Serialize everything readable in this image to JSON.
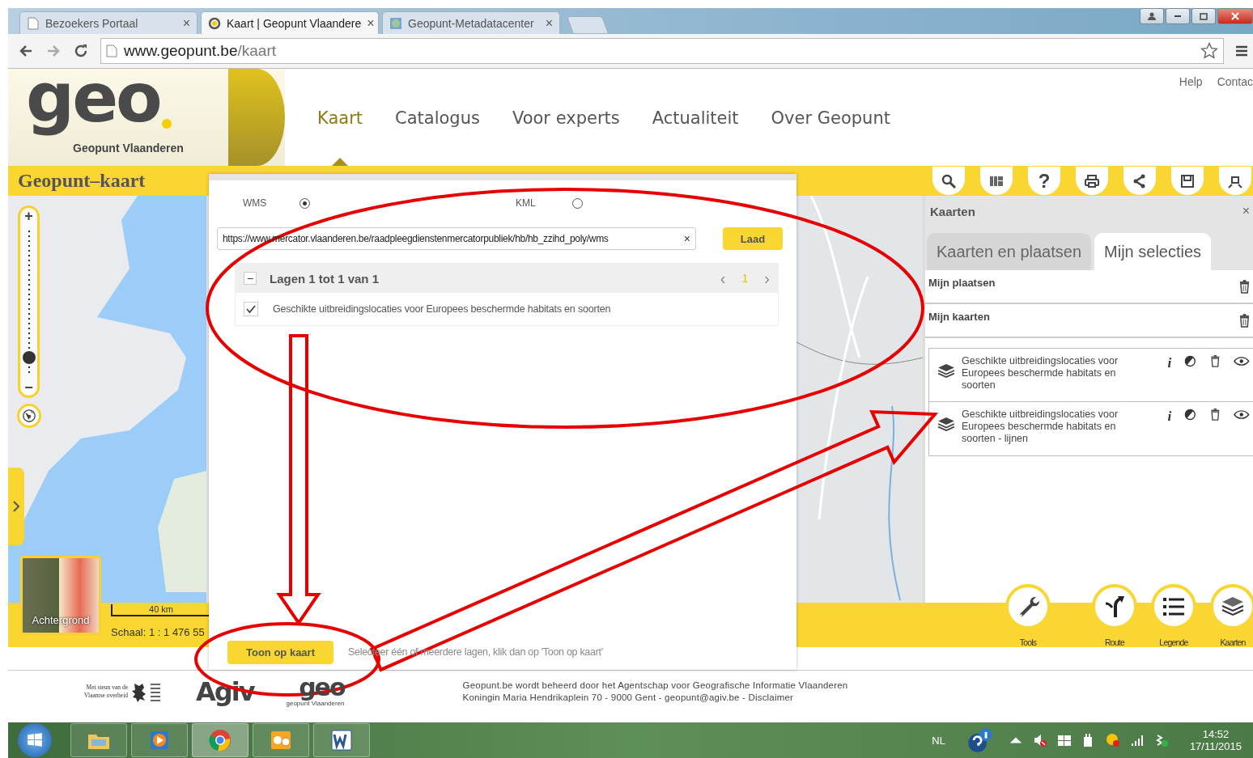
{
  "browser": {
    "tabs": [
      {
        "title": "Bezoekers Portaal",
        "close": "×",
        "selected": false,
        "kind": "page"
      },
      {
        "title": "Kaart | Geopunt Vlaandere",
        "close": "×",
        "selected": true,
        "kind": "geo"
      },
      {
        "title": "Geopunt-Metadatacenter",
        "close": "×",
        "selected": false,
        "kind": "globe"
      }
    ],
    "address": {
      "host": "www.geopunt.be",
      "path": "/kaart"
    }
  },
  "header": {
    "logo": {
      "text": "geo",
      "subtitle": "Geopunt Vlaanderen"
    },
    "nav": [
      {
        "label": "Kaart",
        "selected": true
      },
      {
        "label": "Catalogus",
        "selected": false
      },
      {
        "label": "Voor experts",
        "selected": false
      },
      {
        "label": "Actualiteit",
        "selected": false
      },
      {
        "label": "Over Geopunt",
        "selected": false
      }
    ],
    "links": [
      "Help",
      "Contac"
    ]
  },
  "map": {
    "title": "Geopunt–kaart",
    "toolbar_help": "?",
    "zoom": {
      "plus": "+",
      "minus": "−",
      "level": 0.08
    },
    "background_label": "Achtergrond",
    "scale_bar": "40 km",
    "scale": "Schaal: 1 : 1 476 55"
  },
  "dialog": {
    "formats": [
      {
        "label": "WMS",
        "selected": true
      },
      {
        "label": "KML",
        "selected": false
      }
    ],
    "url": "https://www.mercator.vlaanderen.be/raadpleegdienstenmercatorpubliek/hb/hb_zzihd_poly/wms",
    "clear": "×",
    "load": "Laad",
    "layers": {
      "collapse": "−",
      "title": "Lagen 1 tot 1 van 1",
      "prev": "‹",
      "page": "1",
      "next": "›",
      "items": [
        {
          "label": "Geschikte uitbreidingslocaties voor Europees beschermde habitats en soorten",
          "checked": true
        }
      ]
    },
    "show": "Toon op kaart",
    "hint": "Selecteer één of meerdere lagen, klik dan op 'Toon op kaart'"
  },
  "panel": {
    "title": "Kaarten",
    "close": "×",
    "tabs": [
      {
        "label": "Kaarten en plaatsen",
        "selected": false
      },
      {
        "label": "Mijn selecties",
        "selected": true
      }
    ],
    "sections": [
      "Mijn plaatsen",
      "Mijn kaarten"
    ],
    "layers": [
      {
        "label": "Geschikte uitbreidingslocaties voor Europees beschermde habitats en soorten",
        "info": "i"
      },
      {
        "label": "Geschikte uitbreidingslocaties voor Europees beschermde habitats en soorten - lijnen",
        "info": "i"
      }
    ]
  },
  "actions": [
    {
      "label": "Tools",
      "kind": "tools"
    },
    {
      "label": "Route",
      "kind": "route"
    },
    {
      "label": "Legende",
      "kind": "legend"
    },
    {
      "label": "Kaarten",
      "kind": "layers"
    }
  ],
  "footer": {
    "sponsor": "Met steun van de Vlaamse overheid",
    "agiv": "Agiv",
    "geo": "geo",
    "geo_sub": "geopunt Vlaanderen",
    "lines": [
      "Geopunt.be wordt beheerd door het Agentschap voor Geografische Informatie Vlaanderen",
      "Koningin Maria Hendrikaplein 70 - 9000 Gent - geopunt@agiv.be - Disclaimer"
    ]
  },
  "taskbar": {
    "apps": [
      {
        "kind": "explorer",
        "selected": false
      },
      {
        "kind": "media",
        "selected": false
      },
      {
        "kind": "chrome",
        "selected": true
      },
      {
        "kind": "outlook",
        "selected": false
      },
      {
        "kind": "word",
        "selected": false
      }
    ],
    "language": "NL",
    "time": "14:52",
    "date": "17/11/2015"
  }
}
